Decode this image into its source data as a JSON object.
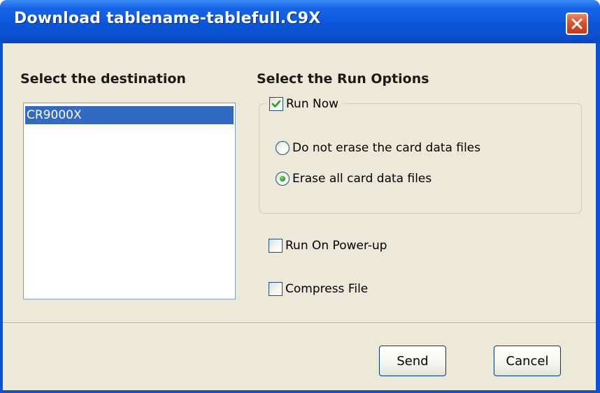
{
  "window": {
    "title": "Download tablename-tablefull.C9X"
  },
  "destination": {
    "heading": "Select the destination",
    "items": [
      {
        "label": "CR9000X",
        "selected": true
      }
    ]
  },
  "run_options": {
    "heading": "Select the Run Options",
    "run_now": {
      "label": "Run Now",
      "checked": true
    },
    "erase_options": [
      {
        "label": "Do not erase the card data files",
        "selected": false
      },
      {
        "label": "Erase all card data files",
        "selected": true
      }
    ],
    "run_on_power_up": {
      "label": "Run On Power-up",
      "checked": false
    },
    "compress_file": {
      "label": "Compress File",
      "checked": false
    }
  },
  "buttons": {
    "send": "Send",
    "cancel": "Cancel"
  },
  "colors": {
    "titlebar": "#0a56d9",
    "dialog_bg": "#ece9d8",
    "selection": "#316ac5",
    "close_button": "#d9502e",
    "checkmark": "#21a121"
  }
}
